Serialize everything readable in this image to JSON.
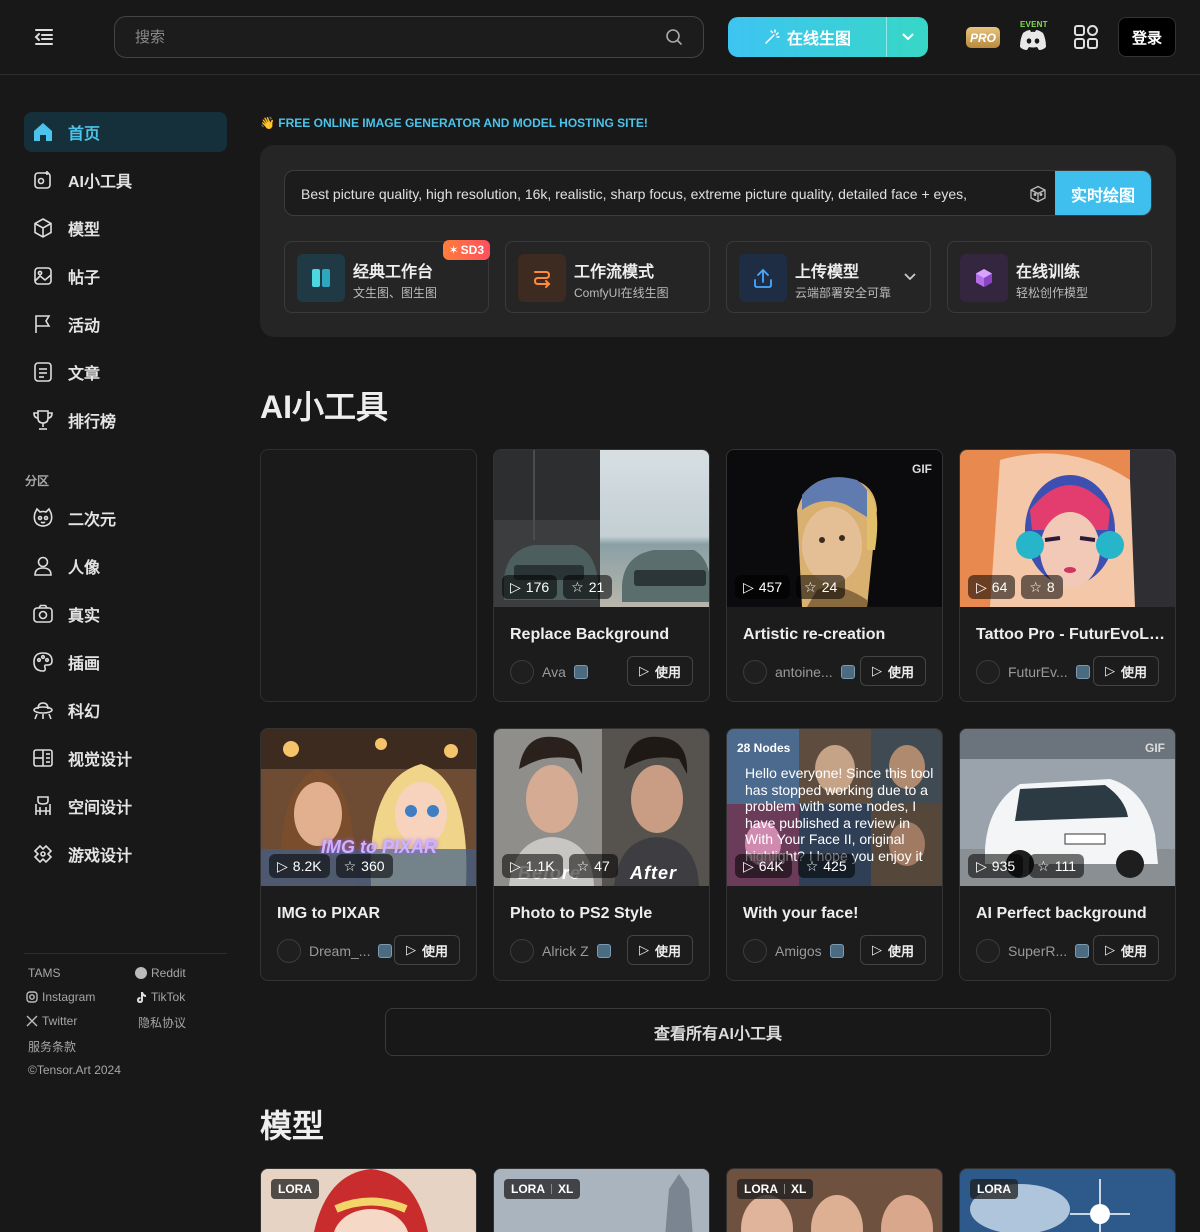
{
  "header": {
    "search_placeholder": "搜索",
    "generate_label": "在线生图",
    "pro_label": "PRO",
    "event_label": "EVENT",
    "login_label": "登录"
  },
  "sidebar": {
    "items": [
      {
        "label": "首页",
        "icon": "home-icon",
        "active": true
      },
      {
        "label": "AI小工具",
        "icon": "ai-tools-icon"
      },
      {
        "label": "模型",
        "icon": "cube-icon"
      },
      {
        "label": "帖子",
        "icon": "image-icon"
      },
      {
        "label": "活动",
        "icon": "flag-icon"
      },
      {
        "label": "文章",
        "icon": "document-icon"
      },
      {
        "label": "排行榜",
        "icon": "trophy-icon"
      }
    ],
    "section_label": "分区",
    "sections": [
      {
        "label": "二次元",
        "icon": "anime-face-icon"
      },
      {
        "label": "人像",
        "icon": "person-icon"
      },
      {
        "label": "真实",
        "icon": "camera-icon"
      },
      {
        "label": "插画",
        "icon": "palette-icon"
      },
      {
        "label": "科幻",
        "icon": "ufo-icon"
      },
      {
        "label": "视觉设计",
        "icon": "layout-icon"
      },
      {
        "label": "空间设计",
        "icon": "interior-icon"
      },
      {
        "label": "游戏设计",
        "icon": "gamepad-icon"
      }
    ],
    "footer": {
      "tams": "TAMS",
      "reddit": "Reddit",
      "instagram": "Instagram",
      "tiktok": "TikTok",
      "twitter": "Twitter",
      "privacy": "隐私协议",
      "terms": "服务条款",
      "copyright": "©Tensor.Art 2024"
    }
  },
  "main": {
    "tagline": "👋 FREE ONLINE IMAGE GENERATOR AND MODEL HOSTING SITE!",
    "prompt_text": "Best picture quality, high resolution, 16k, realistic, sharp focus, extreme picture quality, detailed face + eyes,",
    "realtime_label": "实时绘图",
    "quick_actions": [
      {
        "title": "经典工作台",
        "subtitle": "文生图、图生图",
        "badge": "SD3",
        "icon": "workbench-icon",
        "color": "#1f3a44"
      },
      {
        "title": "工作流模式",
        "subtitle": "ComfyUI在线生图",
        "icon": "workflow-icon",
        "color": "#3d2a20"
      },
      {
        "title": "上传模型",
        "subtitle": "云端部署安全可靠",
        "icon": "upload-icon",
        "color": "#1f2d44"
      },
      {
        "title": "在线训练",
        "subtitle": "轻松创作模型",
        "icon": "training-icon",
        "color": "#34263f"
      }
    ],
    "tools_heading": "AI小工具",
    "tools": [
      {
        "title": "Replace Background",
        "runs": "176",
        "stars": "21",
        "author": "Ava",
        "use": "使用"
      },
      {
        "title": "Artistic re-creation",
        "runs": "457",
        "stars": "24",
        "author": "antoine...",
        "use": "使用",
        "gif": "GIF"
      },
      {
        "title": "Tattoo Pro - FuturEvoLab",
        "runs": "64",
        "stars": "8",
        "author": "FuturEv...",
        "use": "使用"
      },
      {
        "title": "IMG to PIXAR",
        "runs": "8.2K",
        "stars": "360",
        "author": "Dream_...",
        "use": "使用",
        "overlay": "IMG to PIXAR"
      },
      {
        "title": "Photo to PS2 Style",
        "runs": "1.1K",
        "stars": "47",
        "author": "Alrick Z",
        "use": "使用",
        "before": "Before",
        "after": "After"
      },
      {
        "title": "With your face!",
        "runs": "64K",
        "stars": "425",
        "author": "Amigos",
        "use": "使用",
        "nodes": "28 Nodes",
        "overlay": "Hello everyone! Since this tool has stopped working due to a problem with some nodes, I have published a review in With Your Face II, original highlight? I hope you enjoy it"
      },
      {
        "title": "AI Perfect background",
        "runs": "935",
        "stars": "111",
        "author": "SuperR...",
        "use": "使用",
        "gif": "GIF"
      }
    ],
    "view_all": "查看所有AI小工具",
    "models_heading": "模型",
    "models": [
      {
        "tags": [
          "LORA"
        ]
      },
      {
        "tags": [
          "LORA",
          "XL"
        ]
      },
      {
        "tags": [
          "LORA",
          "XL"
        ]
      },
      {
        "tags": [
          "LORA"
        ]
      }
    ],
    "colors": {
      "accent": "#4cc3ea",
      "active_bg": "#15303a",
      "badge": "#ff5f4a"
    }
  }
}
